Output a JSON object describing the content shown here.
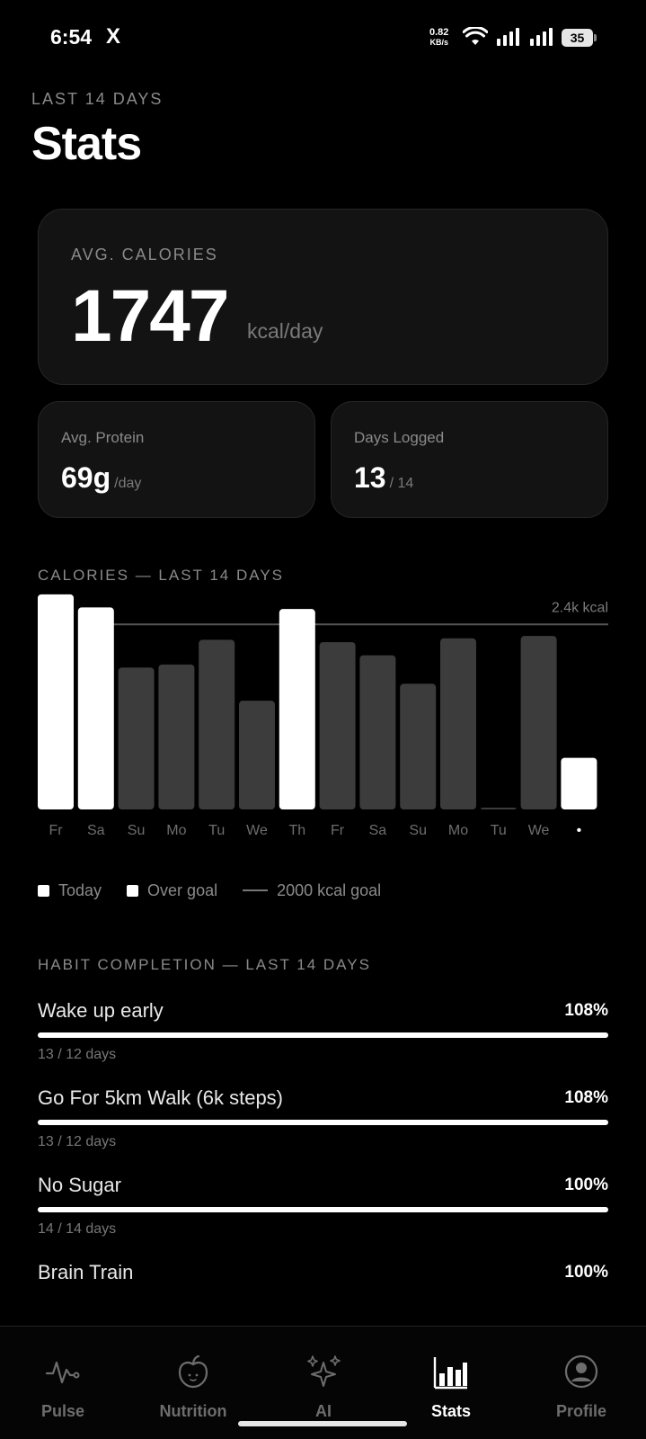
{
  "status_bar": {
    "time": "6:54",
    "app_icon": "X",
    "net_speed": "0.82",
    "net_unit": "KB/s",
    "battery": "35"
  },
  "header": {
    "eyebrow": "LAST 14 DAYS",
    "title": "Stats"
  },
  "avg_calories": {
    "label": "AVG. CALORIES",
    "value": "1747",
    "unit": "kcal/day"
  },
  "avg_protein": {
    "label": "Avg. Protein",
    "value": "69g",
    "unit": "/day"
  },
  "days_logged": {
    "label": "Days Logged",
    "value": "13",
    "unit": "/ 14"
  },
  "calories_section": {
    "title": "CALORIES — LAST 14 DAYS"
  },
  "chart_data": {
    "type": "bar",
    "categories": [
      "Fr",
      "Sa",
      "Su",
      "Mo",
      "Tu",
      "We",
      "Th",
      "Fr",
      "Sa",
      "Su",
      "Mo",
      "Tu",
      "We",
      "•"
    ],
    "values": [
      2790,
      2620,
      1840,
      1880,
      2200,
      1410,
      2600,
      2170,
      2000,
      1630,
      2220,
      0,
      2250,
      670
    ],
    "highlight": [
      "over",
      "over",
      "normal",
      "normal",
      "normal",
      "normal",
      "over",
      "normal",
      "normal",
      "normal",
      "normal",
      "normal",
      "normal",
      "today"
    ],
    "reference_line_label": "2.4k kcal",
    "reference_value": 2400,
    "ylim": [
      0,
      2800
    ],
    "colors": {
      "highlight": "#ffffff",
      "normal": "#3c3c3c",
      "reference": "#555555"
    }
  },
  "legend": {
    "today": "Today",
    "over_goal": "Over goal",
    "goal": "2000 kcal goal"
  },
  "habits_section": {
    "title": "HABIT COMPLETION — LAST 14 DAYS"
  },
  "habits": [
    {
      "name": "Wake up early",
      "percent": "108%",
      "progress": 1.08,
      "detail": "13 / 12 days"
    },
    {
      "name": "Go For 5km Walk (6k steps)",
      "percent": "108%",
      "progress": 1.08,
      "detail": "13 / 12 days"
    },
    {
      "name": "No Sugar",
      "percent": "100%",
      "progress": 1.0,
      "detail": "14 / 14 days"
    },
    {
      "name": "Brain Train",
      "percent": "100%",
      "progress": 1.0,
      "detail": ""
    }
  ],
  "nav": {
    "items": [
      {
        "label": "Pulse",
        "icon": "pulse-icon"
      },
      {
        "label": "Nutrition",
        "icon": "apple-icon"
      },
      {
        "label": "AI",
        "icon": "sparkles-icon"
      },
      {
        "label": "Stats",
        "icon": "bar-chart-icon",
        "active": true
      },
      {
        "label": "Profile",
        "icon": "user-circle-icon"
      }
    ]
  }
}
